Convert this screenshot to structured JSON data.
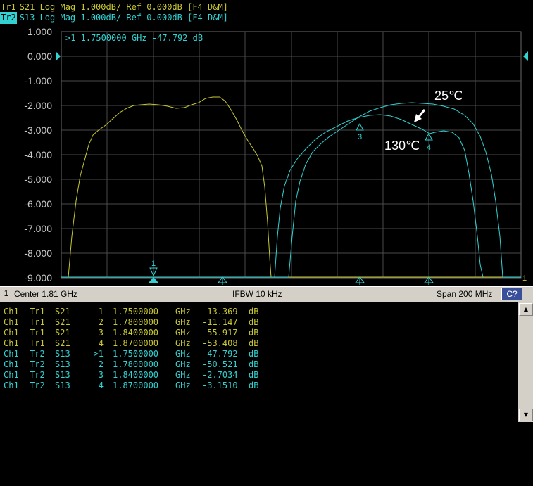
{
  "header": {
    "tr1": {
      "tag": "Tr1",
      "text": "S21 Log Mag 1.000dB/ Ref 0.000dB [F4 D&M]"
    },
    "tr2": {
      "tag": "Tr2",
      "text": "S13 Log Mag 1.000dB/ Ref 0.000dB [F4 D&M]"
    }
  },
  "plot": {
    "marker_readout": ">1  1.7500000 GHz -47.792 dB",
    "y_ticks": [
      "1.000",
      "0.000",
      "-1.000",
      "-2.000",
      "-3.000",
      "-4.000",
      "-5.000",
      "-6.000",
      "-7.000",
      "-8.000",
      "-9.000"
    ],
    "annotation_25": "25℃",
    "annotation_130": "130℃",
    "marker_labels": {
      "m1": "1",
      "m3": "3",
      "m4": "4",
      "right": "1"
    }
  },
  "status": {
    "channel": "1",
    "center": "Center 1.81 GHz",
    "ifbw": "IFBW 10 kHz",
    "span": "Span 200 MHz",
    "cal": "C?"
  },
  "marker_table": [
    {
      "ch": "Ch1",
      "tr": "Tr1",
      "s": "S21",
      "num": "1",
      "freq": "1.7500000",
      "unit": "GHz",
      "val": "-13.369",
      "db": "dB",
      "color": "y"
    },
    {
      "ch": "Ch1",
      "tr": "Tr1",
      "s": "S21",
      "num": "2",
      "freq": "1.7800000",
      "unit": "GHz",
      "val": "-11.147",
      "db": "dB",
      "color": "y"
    },
    {
      "ch": "Ch1",
      "tr": "Tr1",
      "s": "S21",
      "num": "3",
      "freq": "1.8400000",
      "unit": "GHz",
      "val": "-55.917",
      "db": "dB",
      "color": "y"
    },
    {
      "ch": "Ch1",
      "tr": "Tr1",
      "s": "S21",
      "num": "4",
      "freq": "1.8700000",
      "unit": "GHz",
      "val": "-53.408",
      "db": "dB",
      "color": "y"
    },
    {
      "ch": "Ch1",
      "tr": "Tr2",
      "s": "S13",
      "num": ">1",
      "freq": "1.7500000",
      "unit": "GHz",
      "val": "-47.792",
      "db": "dB",
      "color": "c"
    },
    {
      "ch": "Ch1",
      "tr": "Tr2",
      "s": "S13",
      "num": "2",
      "freq": "1.7800000",
      "unit": "GHz",
      "val": "-50.521",
      "db": "dB",
      "color": "c"
    },
    {
      "ch": "Ch1",
      "tr": "Tr2",
      "s": "S13",
      "num": "3",
      "freq": "1.8400000",
      "unit": "GHz",
      "val": "-2.7034",
      "db": "dB",
      "color": "c"
    },
    {
      "ch": "Ch1",
      "tr": "Tr2",
      "s": "S13",
      "num": "4",
      "freq": "1.8700000",
      "unit": "GHz",
      "val": "-3.1510",
      "db": "dB",
      "color": "c"
    }
  ],
  "colors": {
    "tr1": "#c8c832",
    "tr2": "#32d2d2",
    "grid": "#4a4a4a"
  }
}
